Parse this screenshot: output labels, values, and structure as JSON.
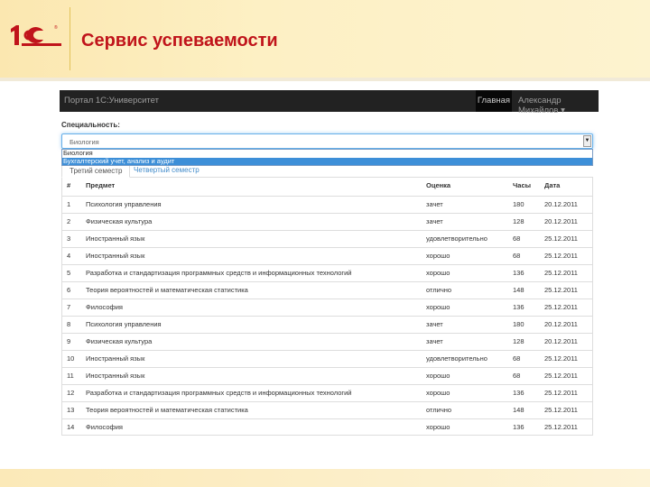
{
  "header": {
    "logo_text": "1С",
    "title": "Сервис успеваемости"
  },
  "nav": {
    "brand": "Портал 1С:Университет",
    "home": "Главная",
    "user": "Александр Михайлов ▾"
  },
  "form": {
    "label": "Специальность:",
    "selected": "Биология",
    "options": [
      "Биология",
      "Бухгалтерский учет, анализ и аудит"
    ],
    "highlighted_index": 1
  },
  "tabs": [
    "Третий семестр",
    "Четвертый семестр"
  ],
  "table": {
    "headers": [
      "#",
      "Предмет",
      "Оценка",
      "Часы",
      "Дата"
    ],
    "rows": [
      [
        "1",
        "Психология управления",
        "зачет",
        "180",
        "20.12.2011"
      ],
      [
        "2",
        "Физическая культура",
        "зачет",
        "128",
        "20.12.2011"
      ],
      [
        "3",
        "Иностранный язык",
        "удовлетворительно",
        "68",
        "25.12.2011"
      ],
      [
        "4",
        "Иностранный язык",
        "хорошо",
        "68",
        "25.12.2011"
      ],
      [
        "5",
        "Разработка и стандартизация программных средств и информационных технологий",
        "хорошо",
        "136",
        "25.12.2011"
      ],
      [
        "6",
        "Теория вероятностей и математическая статистика",
        "отлично",
        "148",
        "25.12.2011"
      ],
      [
        "7",
        "Философия",
        "хорошо",
        "136",
        "25.12.2011"
      ],
      [
        "8",
        "Психология управления",
        "зачет",
        "180",
        "20.12.2011"
      ],
      [
        "9",
        "Физическая культура",
        "зачет",
        "128",
        "20.12.2011"
      ],
      [
        "10",
        "Иностранный язык",
        "удовлетворительно",
        "68",
        "25.12.2011"
      ],
      [
        "11",
        "Иностранный язык",
        "хорошо",
        "68",
        "25.12.2011"
      ],
      [
        "12",
        "Разработка и стандартизация программных средств и информационных технологий",
        "хорошо",
        "136",
        "25.12.2011"
      ],
      [
        "13",
        "Теория вероятностей и математическая статистика",
        "отлично",
        "148",
        "25.12.2011"
      ],
      [
        "14",
        "Философия",
        "хорошо",
        "136",
        "25.12.2011"
      ]
    ]
  }
}
